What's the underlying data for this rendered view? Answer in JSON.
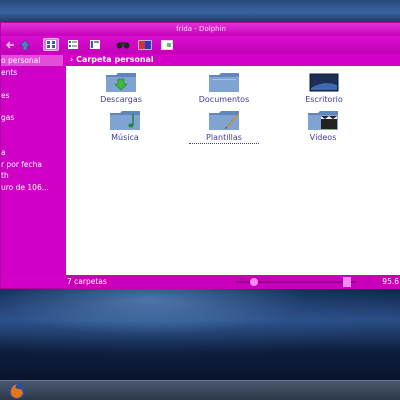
{
  "window": {
    "title": "frida - Dolphin"
  },
  "sidebar": {
    "items": [
      {
        "label": "o personal",
        "active": true
      },
      {
        "label": "ents",
        "active": false
      },
      {
        "label": "es",
        "active": false
      },
      {
        "label": "gas",
        "active": false
      },
      {
        "label": "a",
        "active": false
      },
      {
        "label": "r por fecha",
        "active": false
      },
      {
        "label": "th",
        "active": false
      },
      {
        "label": "uro de 106...",
        "active": false
      }
    ]
  },
  "breadcrumb": {
    "label": "Carpeta personal"
  },
  "folders": [
    {
      "label": "Descargas",
      "icon": "download-folder-icon"
    },
    {
      "label": "Documentos",
      "icon": "documents-folder-icon"
    },
    {
      "label": "Escritorio",
      "icon": "desktop-folder-icon"
    },
    {
      "label": "Música",
      "icon": "music-folder-icon"
    },
    {
      "label": "Plantillas",
      "icon": "templates-folder-icon"
    },
    {
      "label": "Vídeos",
      "icon": "videos-folder-icon"
    }
  ],
  "status": {
    "text": "7 carpetas",
    "zoom": "95.6"
  },
  "colors": {
    "window_accent": "#d400c8",
    "folder_label": "#3d3d9a",
    "folder_body": "#6a8fc0"
  }
}
